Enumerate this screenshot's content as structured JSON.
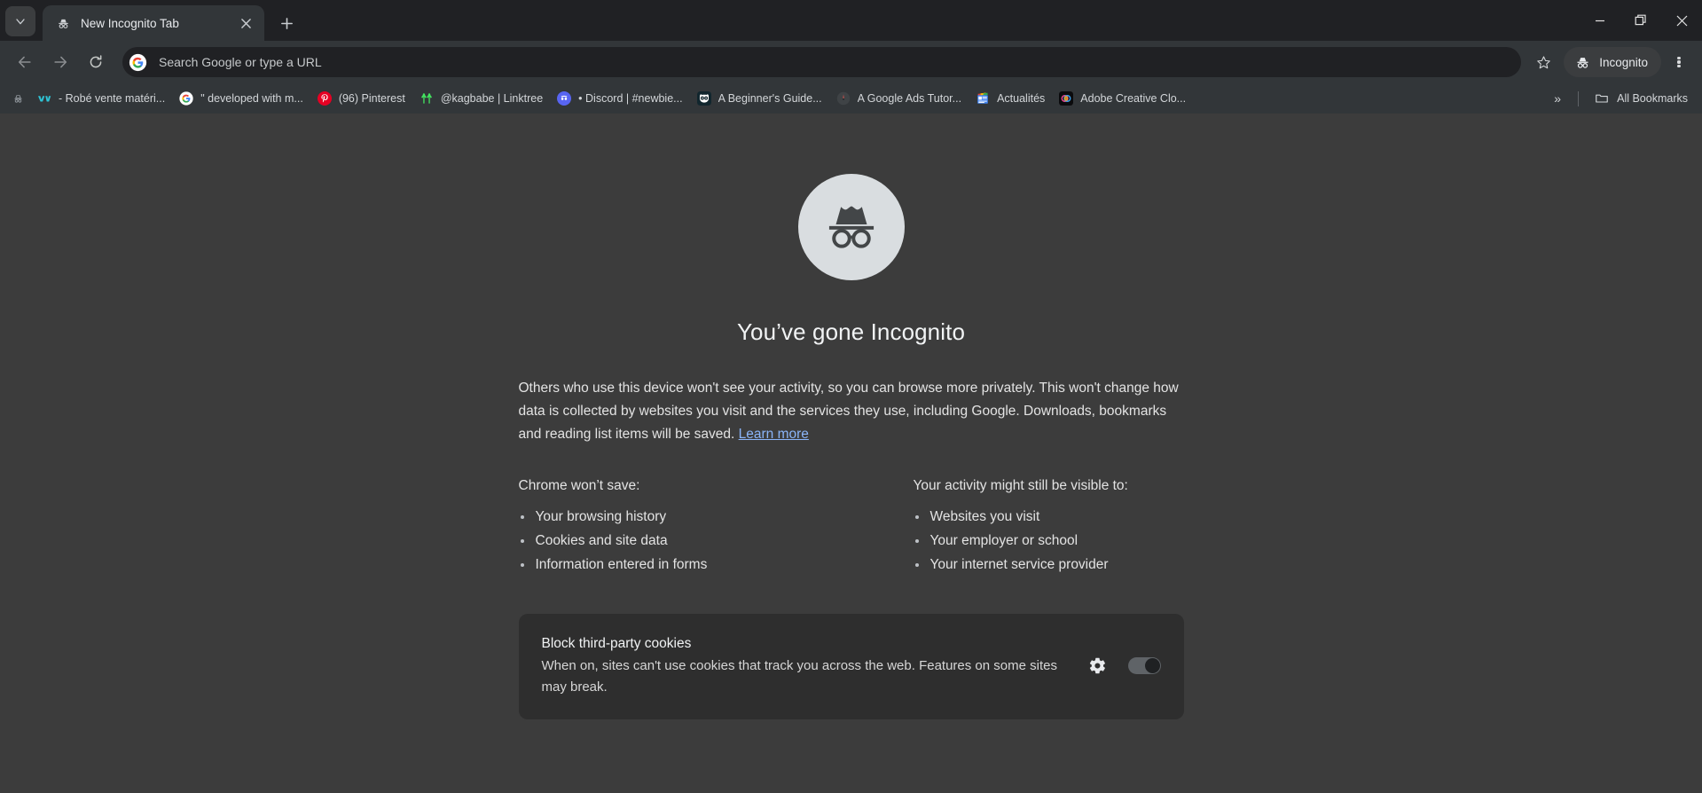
{
  "window": {
    "minimize_label": "Minimize",
    "maximize_label": "Restore",
    "close_label": "Close"
  },
  "tabstrip": {
    "tab_search_label": "Search tabs",
    "new_tab_label": "New tab",
    "tabs": [
      {
        "title": "New Incognito Tab",
        "favicon": "incognito-icon",
        "active": true,
        "close_label": "Close tab"
      }
    ]
  },
  "toolbar": {
    "back_label": "Back",
    "forward_label": "Forward",
    "reload_label": "Reload",
    "omnibox": {
      "placeholder": "Search Google or type a URL",
      "value": "Search Google or type a URL",
      "leading_icon": "google-g-icon"
    },
    "bookmark_star_label": "Bookmark this tab",
    "profile_pill_label": "Incognito",
    "menu_label": "Customize and control Google Chrome"
  },
  "bookmarks_bar": {
    "items": [
      {
        "label": "",
        "icon": "incognito-small-icon",
        "icon_type": "glyph"
      },
      {
        "label": "- Robé vente matéri...",
        "icon": "webflow-icon",
        "icon_type": "webflow"
      },
      {
        "label": "\" developed with m...",
        "icon": "google-g-icon",
        "icon_type": "google"
      },
      {
        "label": "(96) Pinterest",
        "icon": "pinterest-icon",
        "icon_type": "pinterest"
      },
      {
        "label": "@kagbabe | Linktree",
        "icon": "linktree-icon",
        "icon_type": "linktree"
      },
      {
        "label": "• Discord | #newbie...",
        "icon": "discord-icon",
        "icon_type": "discord"
      },
      {
        "label": "A Beginner's Guide...",
        "icon": "hubspot-icon",
        "icon_type": "hubspot"
      },
      {
        "label": "A Google Ads Tutor...",
        "icon": "dark-circle-icon",
        "icon_type": "darkcircle"
      },
      {
        "label": "Actualités",
        "icon": "google-news-icon",
        "icon_type": "gnews"
      },
      {
        "label": "Adobe Creative Clo...",
        "icon": "adobe-cc-icon",
        "icon_type": "adobe"
      }
    ],
    "overflow_label": "»",
    "all_bookmarks_label": "All Bookmarks"
  },
  "page": {
    "avatar_icon": "incognito-avatar-icon",
    "title": "You’ve gone Incognito",
    "intro": {
      "text": "Others who use this device won't see your activity, so you can browse more privately. This won't change how data is collected by websites you visit and the services they use, including Google. Downloads, bookmarks and reading list items will be saved. ",
      "link_label": "Learn more"
    },
    "columns": [
      {
        "heading": "Chrome won’t save:",
        "items": [
          "Your browsing history",
          "Cookies and site data",
          "Information entered in forms"
        ]
      },
      {
        "heading": "Your activity might still be visible to:",
        "items": [
          "Websites you visit",
          "Your employer or school",
          "Your internet service provider"
        ]
      }
    ],
    "cookie_card": {
      "title": "Block third-party cookies",
      "description": "When on, sites can't use cookies that track you across the web. Features on some sites may break.",
      "settings_label": "Cookie settings",
      "toggle_label": "Block third-party cookies toggle",
      "toggle_state": "on"
    }
  },
  "colors": {
    "chrome_frame": "#202124",
    "toolbar": "#323639",
    "page_background": "#3c3c3c",
    "card_background": "#2e2e2e",
    "link": "#8ab4f8",
    "avatar_circle": "#d9dde0"
  }
}
